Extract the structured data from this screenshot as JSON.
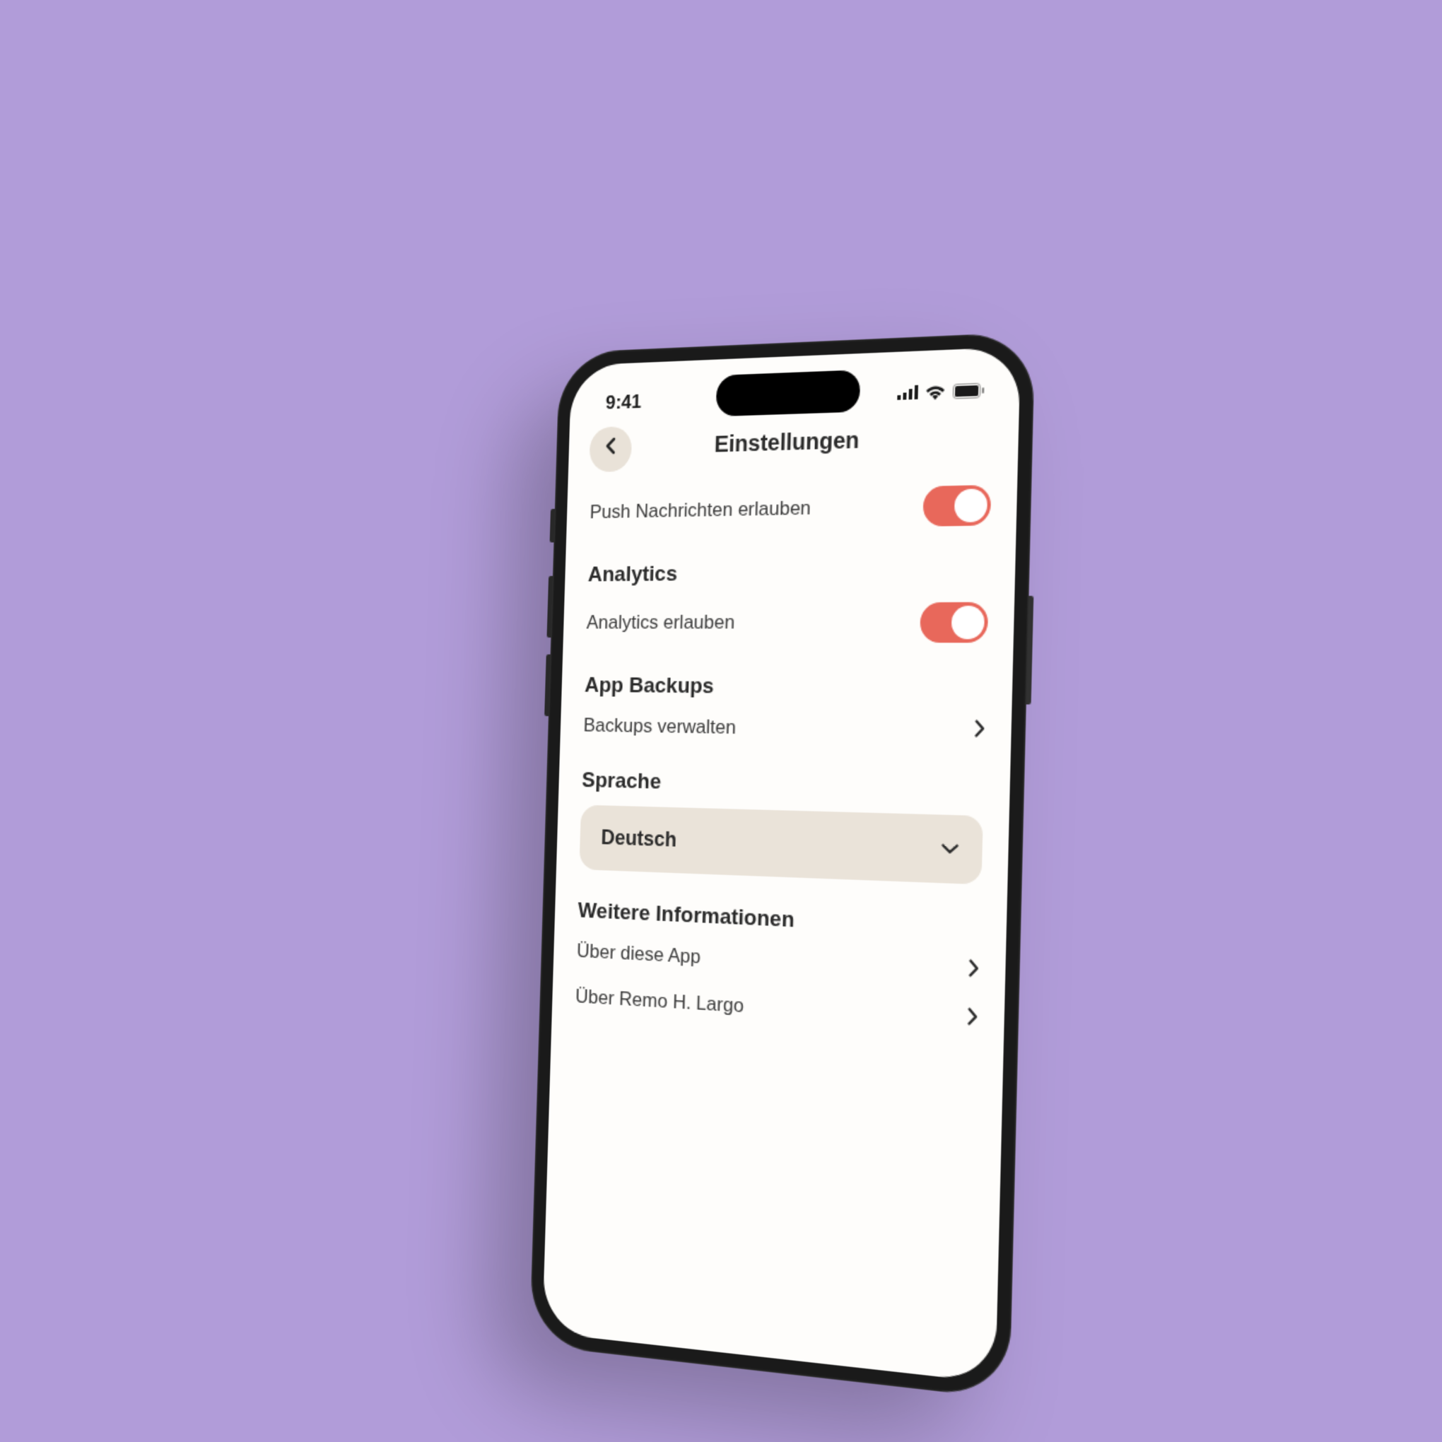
{
  "status": {
    "time": "9:41"
  },
  "header": {
    "title": "Einstellungen"
  },
  "push": {
    "label": "Push Nachrichten erlauben",
    "enabled": true
  },
  "analytics": {
    "heading": "Analytics",
    "label": "Analytics erlauben",
    "enabled": true
  },
  "backups": {
    "heading": "App Backups",
    "label": "Backups verwalten"
  },
  "language": {
    "heading": "Sprache",
    "selected": "Deutsch"
  },
  "info": {
    "heading": "Weitere Informationen",
    "items": [
      {
        "label": "Über diese App"
      },
      {
        "label": "Über Remo H. Largo"
      }
    ]
  },
  "colors": {
    "accent": "#e8685b",
    "neutral_bg": "#eae3d9"
  }
}
